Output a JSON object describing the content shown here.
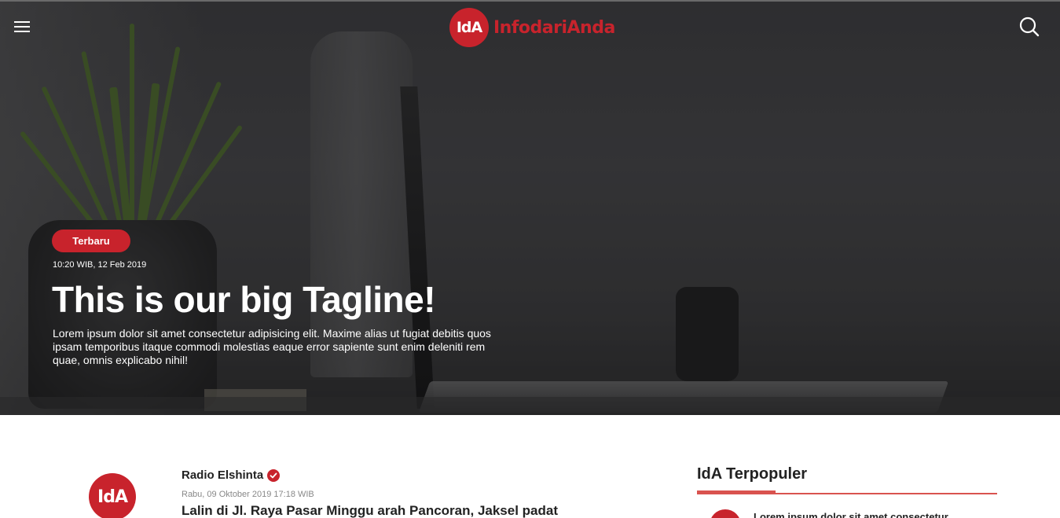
{
  "header": {
    "logo_mark": "IdA",
    "brand_name": "InfodariAnda"
  },
  "hero": {
    "badge": "Terbaru",
    "date": "10:20 WIB, 12 Feb 2019",
    "title": "This is our big Tagline!",
    "description": "Lorem ipsum dolor sit amet consectetur adipisicing elit. Maxime alias ut fugiat debitis quos ipsam temporibus itaque commodi molestias eaque error sapiente sunt enim deleniti rem quae, omnis explicabo nihil!"
  },
  "feed": {
    "post": {
      "avatar_mark": "IdA",
      "source": "Radio Elshinta",
      "date": "Rabu, 09 Oktober 2019 17:18 WIB",
      "headline": "Lalin di Jl. Raya Pasar Minggu arah Pancoran, Jaksel padat"
    }
  },
  "sidebar": {
    "title": "IdA Terpopuler",
    "items": [
      {
        "text": "Lorem ipsum dolor sit amet consectetur"
      }
    ]
  },
  "colors": {
    "brand_red": "#c8232c",
    "accent_rule": "#d9534f"
  }
}
